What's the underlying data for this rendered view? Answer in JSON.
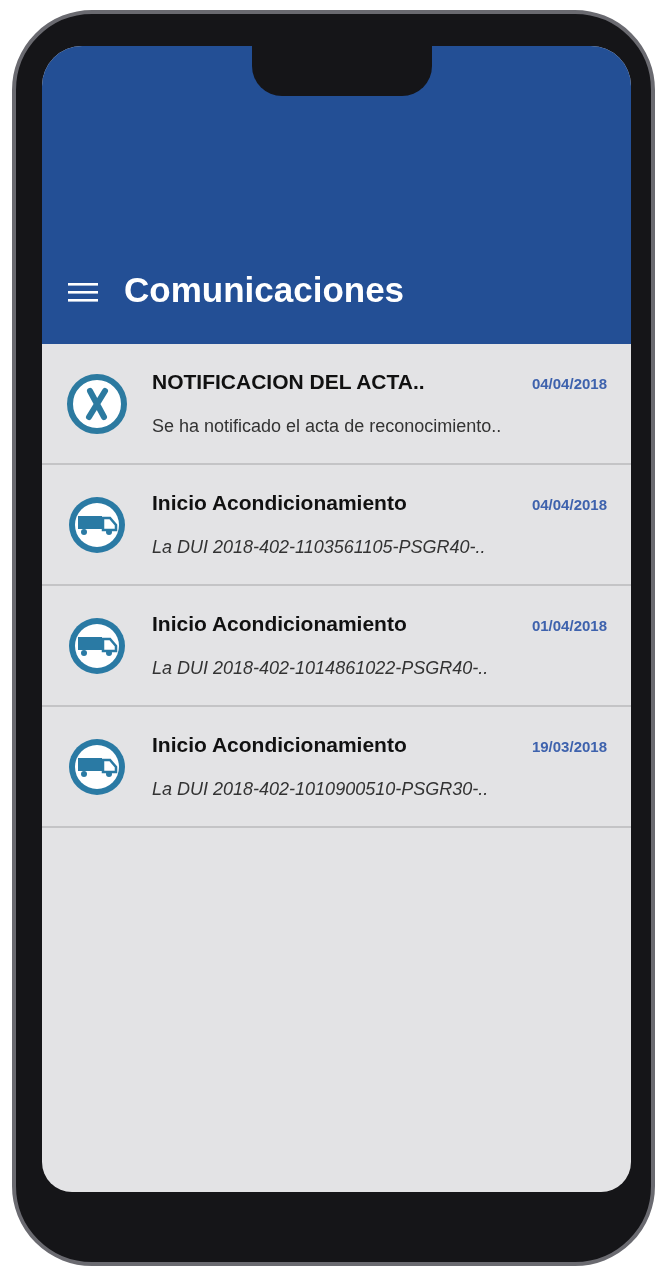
{
  "app_bar": {
    "title": "Comunicaciones"
  },
  "messages": [
    {
      "kind": "cancel",
      "title": "NOTIFICACION DEL ACTA..",
      "date": "04/04/2018",
      "summary": "Se ha notificado el acta de reconocimiento.."
    },
    {
      "kind": "truck",
      "title": "Inicio Acondicionamiento",
      "date": "04/04/2018",
      "summary": "La DUI 2018-402-1103561105-PSGR40-.."
    },
    {
      "kind": "truck",
      "title": "Inicio Acondicionamiento",
      "date": "01/04/2018",
      "summary": "La DUI 2018-402-1014861022-PSGR40-.."
    },
    {
      "kind": "truck",
      "title": "Inicio Acondicionamiento",
      "date": "19/03/2018",
      "summary": "La DUI 2018-402-1010900510-PSGR30-.."
    }
  ]
}
